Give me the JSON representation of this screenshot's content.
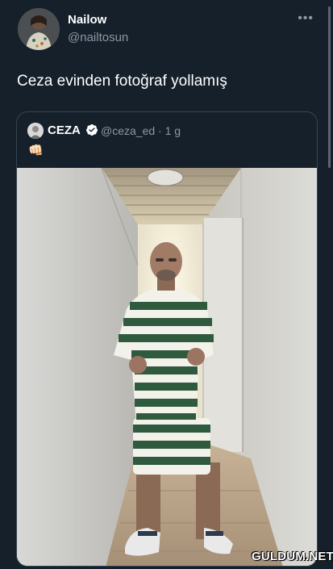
{
  "tweet": {
    "author_name": "Nailow",
    "author_handle": "@nailtosun",
    "more_icon": "more-horizontal-icon",
    "text": "Ceza evinden fotoğraf yollamış"
  },
  "quoted_tweet": {
    "author_name": "CEZA",
    "verified_icon": "verified-badge-icon",
    "author_handle": "@ceza_ed",
    "timestamp": "· 1 g",
    "emoji": "👊🏻"
  },
  "watermark": "GULDUM.NET",
  "colors": {
    "background": "#15202b",
    "border": "#38444d",
    "secondary_text": "#8b98a5",
    "verified_blue": "#1d9bf0"
  }
}
